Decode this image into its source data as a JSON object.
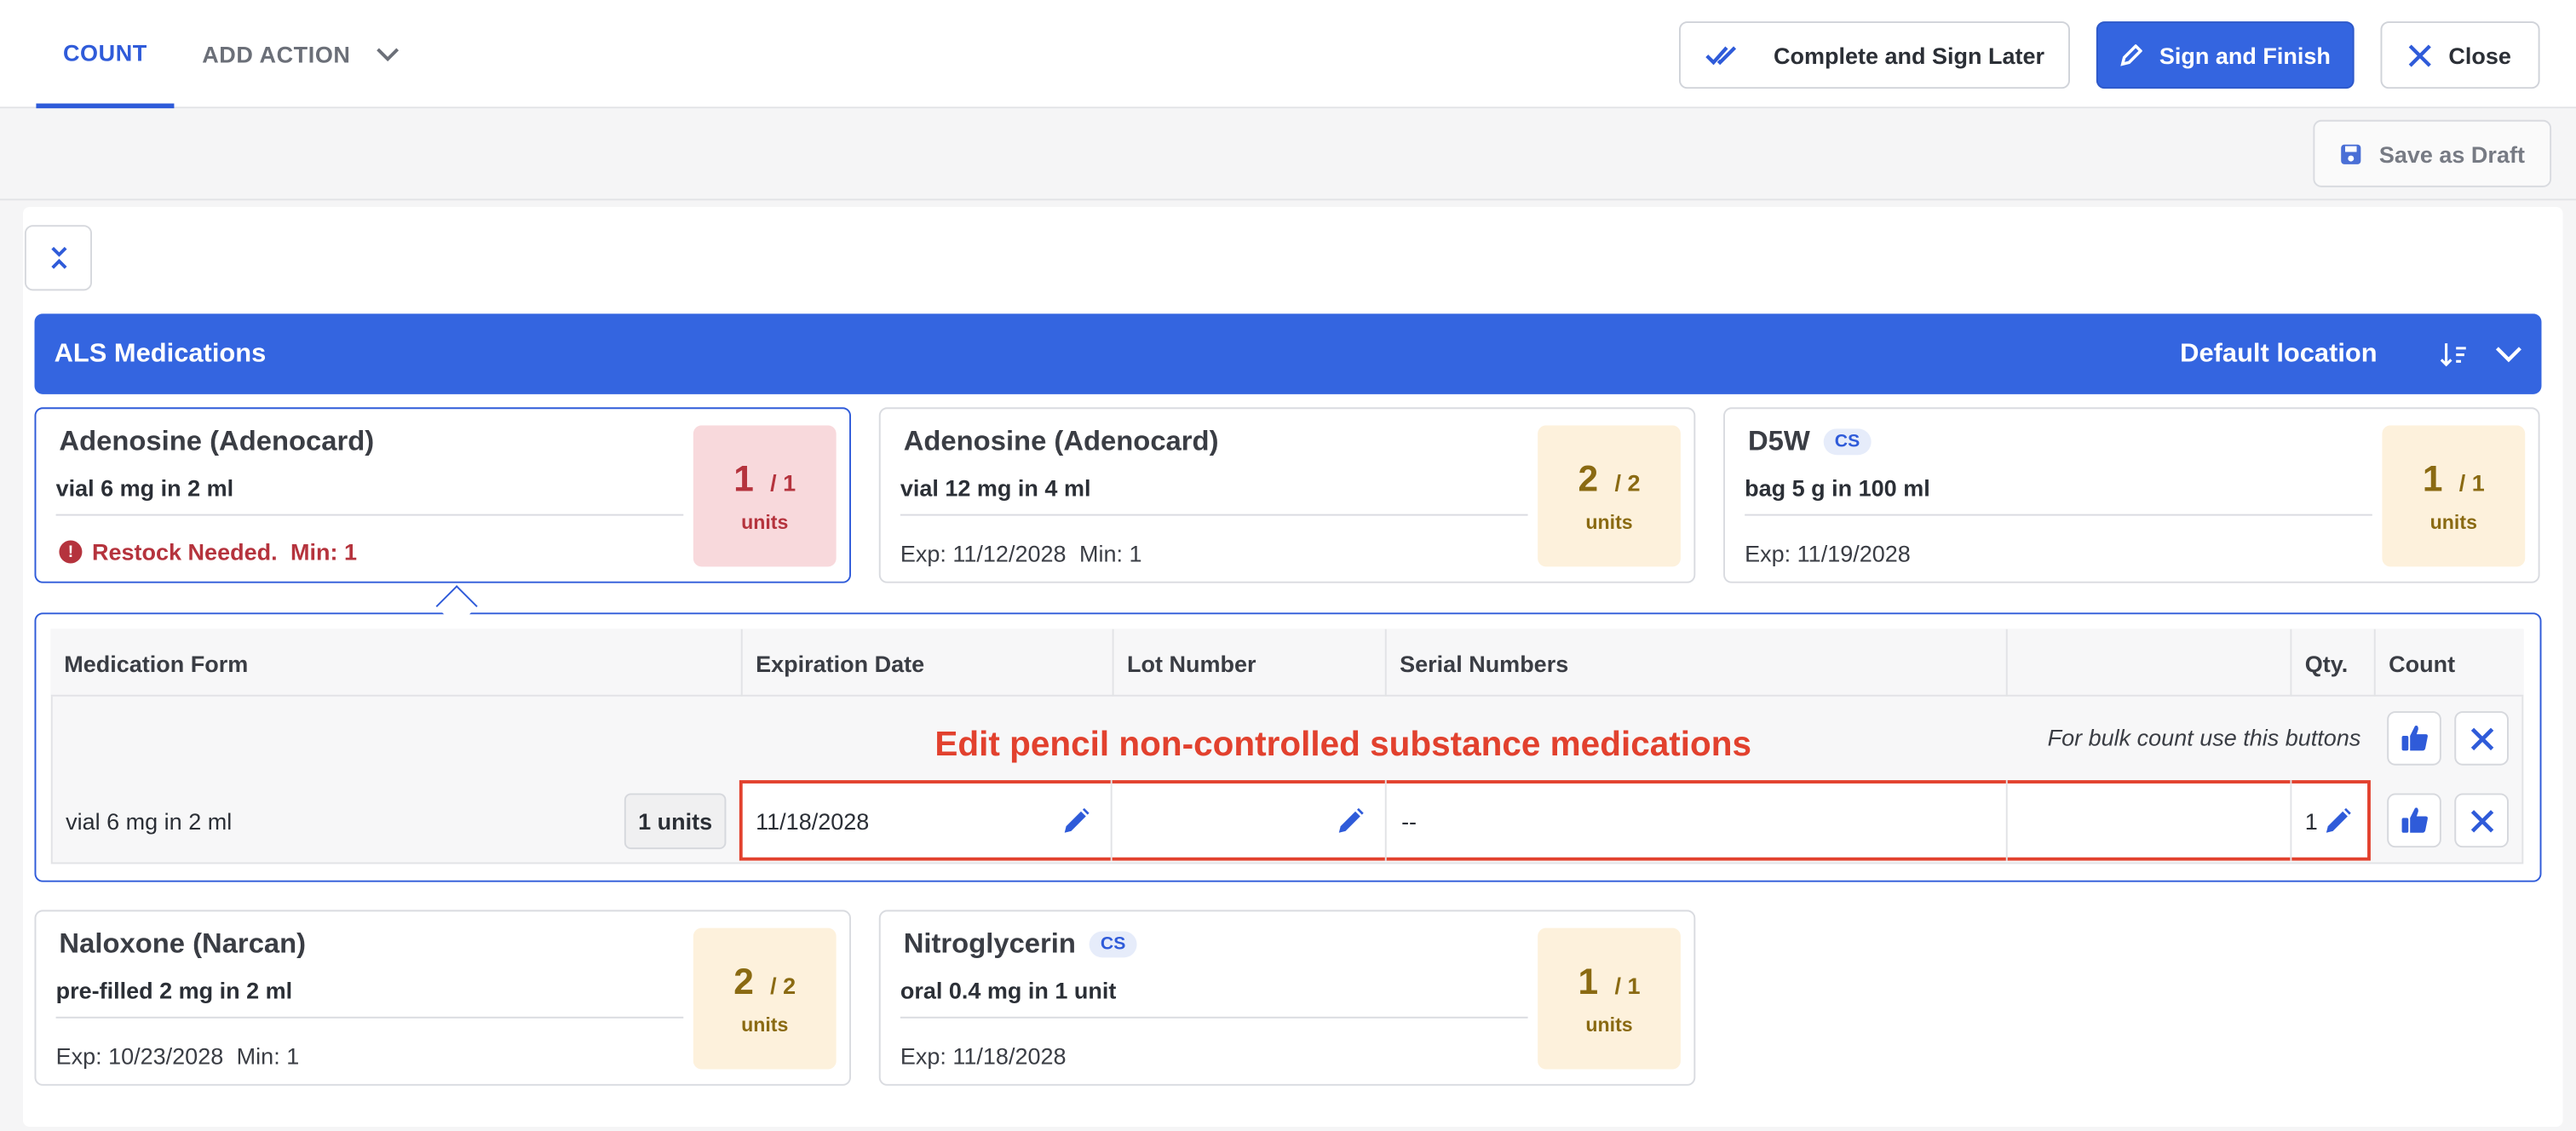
{
  "tabs": {
    "count": "COUNT",
    "add_action": "ADD ACTION"
  },
  "actions": {
    "complete_sign_later": "Complete and Sign Later",
    "sign_and_finish": "Sign and Finish",
    "close": "Close",
    "save_as_draft": "Save as Draft"
  },
  "section": {
    "title": "ALS Medications",
    "location": "Default location"
  },
  "cards": [
    {
      "name": "Adenosine (Adenocard)",
      "cs": "",
      "desc": "vial 6 mg in 2 ml",
      "exp": "",
      "min": "",
      "restock": "Restock Needed.",
      "restock_min": "Min: 1",
      "qty": "1",
      "total": "/ 1",
      "unit": "units",
      "status": "alert"
    },
    {
      "name": "Adenosine (Adenocard)",
      "cs": "",
      "desc": "vial 12 mg in 4 ml",
      "exp": "Exp: 11/12/2028",
      "min": "Min: 1",
      "qty": "2",
      "total": "/ 2",
      "unit": "units",
      "status": "ok"
    },
    {
      "name": "D5W",
      "cs": "CS",
      "desc": "bag 5 g in 100 ml",
      "exp": "Exp: 11/19/2028",
      "min": "",
      "qty": "1",
      "total": "/ 1",
      "unit": "units",
      "status": "ok"
    },
    {
      "name": "Naloxone (Narcan)",
      "cs": "",
      "desc": "pre-filled 2 mg in 2 ml",
      "exp": "Exp: 10/23/2028",
      "min": "Min: 1",
      "qty": "2",
      "total": "/ 2",
      "unit": "units",
      "status": "ok"
    },
    {
      "name": "Nitroglycerin",
      "cs": "CS",
      "desc": "oral 0.4 mg in 1 unit",
      "exp": "Exp: 11/18/2028",
      "min": "",
      "qty": "1",
      "total": "/ 1",
      "unit": "units",
      "status": "ok"
    }
  ],
  "detail": {
    "columns": [
      "Medication Form",
      "Expiration Date",
      "Lot Number",
      "Serial Numbers",
      "",
      "Qty.",
      "Count"
    ],
    "annotation": "Edit pencil non-controlled substance medications",
    "bulk_hint": "For bulk count use this buttons",
    "row": {
      "form": "vial 6 mg in 2 ml",
      "units": "1 units",
      "expiration": "11/18/2028",
      "lot": "",
      "serial": "--",
      "qty": "1"
    }
  },
  "colors": {
    "primary": "#3465e0",
    "alert_red": "#b5333d",
    "annotation_red": "#e2412e",
    "qty_bg": "#fdf1dc"
  },
  "icons": [
    "double-check-icon",
    "pen-icon",
    "close-icon",
    "save-icon",
    "collapse-icon",
    "sort-icon",
    "chevron-down-icon",
    "thumbs-up-icon",
    "x-icon",
    "pencil-icon",
    "warning-icon"
  ]
}
